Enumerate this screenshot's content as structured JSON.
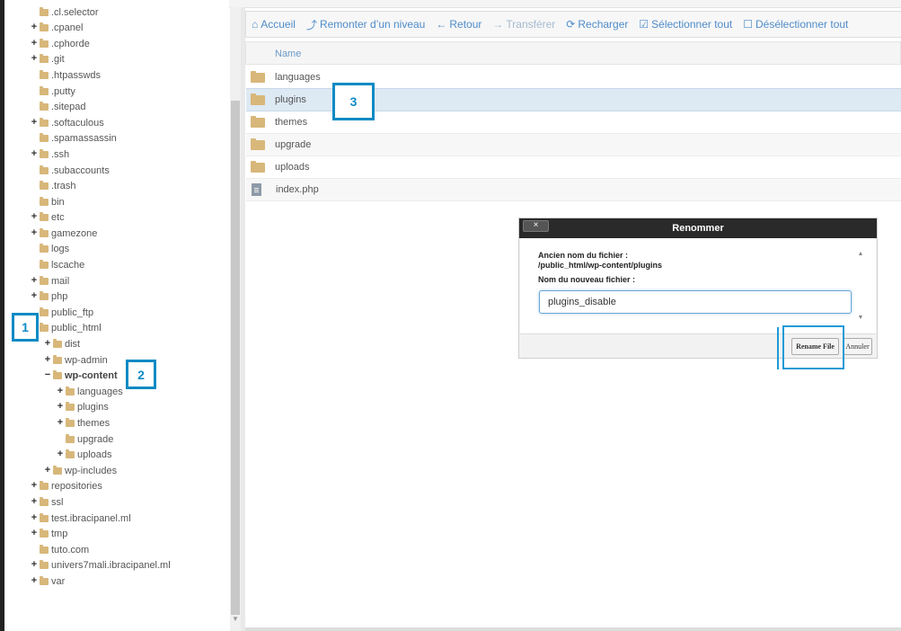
{
  "tree": {
    "items": [
      {
        "label": ".cl.selector",
        "toggle": ""
      },
      {
        "label": ".cpanel",
        "toggle": "+"
      },
      {
        "label": ".cphorde",
        "toggle": "+"
      },
      {
        "label": ".git",
        "toggle": "+"
      },
      {
        "label": ".htpasswds",
        "toggle": ""
      },
      {
        "label": ".putty",
        "toggle": ""
      },
      {
        "label": ".sitepad",
        "toggle": ""
      },
      {
        "label": ".softaculous",
        "toggle": "+"
      },
      {
        "label": ".spamassassin",
        "toggle": ""
      },
      {
        "label": ".ssh",
        "toggle": "+"
      },
      {
        "label": ".subaccounts",
        "toggle": ""
      },
      {
        "label": ".trash",
        "toggle": ""
      },
      {
        "label": "bin",
        "toggle": ""
      },
      {
        "label": "etc",
        "toggle": "+"
      },
      {
        "label": "gamezone",
        "toggle": "+"
      },
      {
        "label": "logs",
        "toggle": ""
      },
      {
        "label": "lscache",
        "toggle": ""
      },
      {
        "label": "mail",
        "toggle": "+"
      },
      {
        "label": "php",
        "toggle": "+"
      },
      {
        "label": "public_ftp",
        "toggle": ""
      },
      {
        "label": "public_html",
        "toggle": "−"
      },
      {
        "label": "dist",
        "toggle": "+"
      },
      {
        "label": "wp-admin",
        "toggle": "+"
      },
      {
        "label": "wp-content",
        "toggle": "−"
      },
      {
        "label": "languages",
        "toggle": "+"
      },
      {
        "label": "plugins",
        "toggle": "+"
      },
      {
        "label": "themes",
        "toggle": "+"
      },
      {
        "label": "upgrade",
        "toggle": ""
      },
      {
        "label": "uploads",
        "toggle": "+"
      },
      {
        "label": "wp-includes",
        "toggle": "+"
      },
      {
        "label": "repositories",
        "toggle": "+"
      },
      {
        "label": "ssl",
        "toggle": "+"
      },
      {
        "label": "test.ibracipanel.ml",
        "toggle": "+"
      },
      {
        "label": "tmp",
        "toggle": "+"
      },
      {
        "label": "tuto.com",
        "toggle": ""
      },
      {
        "label": "univers7mali.ibracipanel.ml",
        "toggle": "+"
      },
      {
        "label": "var",
        "toggle": "+"
      }
    ]
  },
  "toolbar": {
    "home": "Accueil",
    "up": "Remonter d’un niveau",
    "back": "Retour",
    "forward": "Transférer",
    "reload": "Recharger",
    "select_all": "Sélectionner tout",
    "deselect_all": "Désélectionner tout"
  },
  "list": {
    "column_name": "Name",
    "files": [
      {
        "name": "languages",
        "type": "folder"
      },
      {
        "name": "plugins",
        "type": "folder"
      },
      {
        "name": "themes",
        "type": "folder"
      },
      {
        "name": "upgrade",
        "type": "folder"
      },
      {
        "name": "uploads",
        "type": "folder"
      },
      {
        "name": "index.php",
        "type": "file"
      }
    ]
  },
  "dialog": {
    "title": "Renommer",
    "close": "×",
    "old_name_label": "Ancien nom du fichier :",
    "old_name_value": "/public_html/wp-content/plugins",
    "new_name_label": "Nom du nouveau fichier :",
    "new_name_value": "plugins_disable",
    "rename_button": "Rename File",
    "cancel_button": "Annuler"
  },
  "annotations": {
    "step1": "1",
    "step2": "2",
    "step3": "3"
  },
  "colors": {
    "accent": "#4f8cc9",
    "folder": "#d8b77a",
    "annotation": "#0d8bc4",
    "selected_row": "#dde9f3"
  }
}
